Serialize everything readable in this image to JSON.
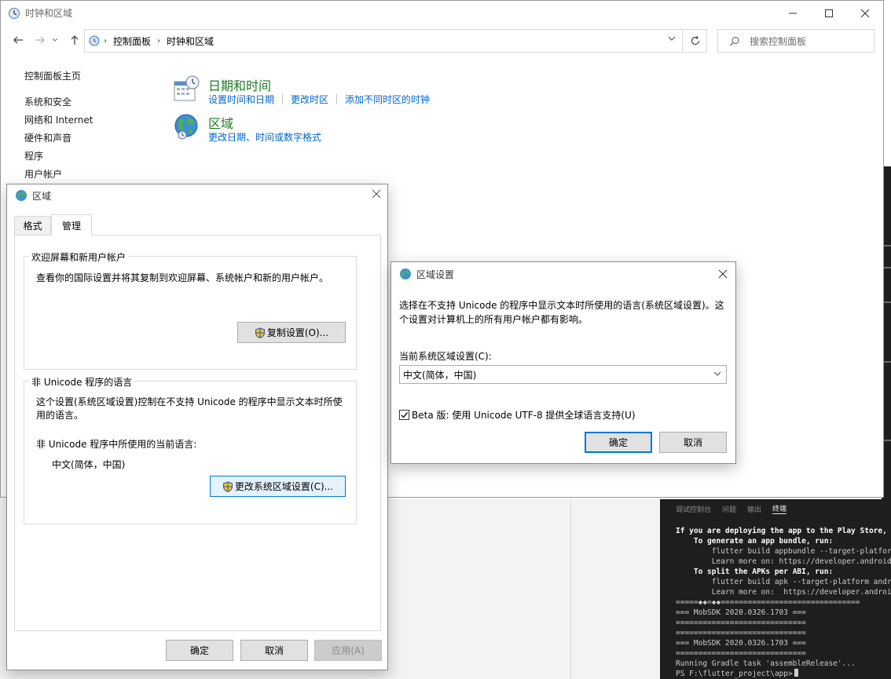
{
  "control_panel": {
    "title": "时钟和区域",
    "breadcrumb": [
      "控制面板",
      "时钟和区域"
    ],
    "search_placeholder": "搜索控制面板",
    "nav_home": "控制面板主页",
    "nav_items": [
      "系统和安全",
      "网络和 Internet",
      "硬件和声音",
      "程序",
      "用户帐户"
    ],
    "categories": [
      {
        "title": "日期和时间",
        "links": [
          "设置时间和日期",
          "更改时区",
          "添加不同时区的时钟"
        ],
        "icon": "clock-calendar-icon"
      },
      {
        "title": "区域",
        "links": [
          "更改日期、时间或数字格式"
        ],
        "icon": "globe-icon"
      }
    ]
  },
  "region_dialog": {
    "title": "区域",
    "tabs": [
      "格式",
      "管理"
    ],
    "active_tab": "管理",
    "welcome_group": {
      "label": "欢迎屏幕和新用户帐户",
      "description": "查看你的国际设置并将其复制到欢迎屏幕、系统帐户和新的用户帐户。",
      "copy_button": "复制设置(O)..."
    },
    "unicode_group": {
      "label": "非 Unicode 程序的语言",
      "description_line1": "这个设置(系统区域设置)控制在不支持 Unicode 的程序中显示文本时所使",
      "description_line2": "用的语言。",
      "current_label": "非 Unicode 程序中所使用的当前语言:",
      "current_value": "中文(简体，中国)",
      "change_button": "更改系统区域设置(C)..."
    },
    "ok": "确定",
    "cancel": "取消",
    "apply": "应用(A)"
  },
  "locale_dialog": {
    "title": "区域设置",
    "description_line1": "选择在不支持 Unicode 的程序中显示文本时所使用的语言(系统区域设置)。这",
    "description_line2": "个设置对计算机上的所有用户帐户都有影响。",
    "current_label": "当前系统区域设置(C):",
    "current_value": "中文(简体，中国)",
    "beta_checkbox": "Beta 版: 使用 Unicode UTF-8 提供全球语言支持(U)",
    "beta_checked": true,
    "ok": "确定",
    "cancel": "取消"
  },
  "terminal": {
    "tabs": [
      "调试控制台",
      "问题",
      "输出",
      "终端"
    ],
    "active_tab": "终端",
    "lines": [
      {
        "text": "If you are deploying the app to the Play Store, it'",
        "bold": true
      },
      {
        "text": "    To generate an app bundle, run:",
        "bold": true
      },
      {
        "text": "        flutter build appbundle --target-platform a",
        "bold": false
      },
      {
        "text": "        Learn more on: https://developer.android.co",
        "bold": false
      },
      {
        "text": "    To split the APKs per ABI, run:",
        "bold": true
      },
      {
        "text": "        flutter build apk --target-platform android",
        "bold": false
      },
      {
        "text": "        Learn more on:  https://developer.android.c",
        "bold": false
      },
      {
        "text": "=====◆◆=◆◆===============================",
        "bold": false
      },
      {
        "text": "=== MobSDK 2020.0326.1703 ===",
        "bold": false
      },
      {
        "text": "=============================",
        "bold": false
      },
      {
        "text": "=============================",
        "bold": false
      },
      {
        "text": "=== MobSDK 2020.0326.1703 ===",
        "bold": false
      },
      {
        "text": "=============================",
        "bold": false
      },
      {
        "text": "Running Gradle task 'assembleRelease'...",
        "bold": false
      },
      {
        "text": "PS F:\\flutter_project\\app>",
        "bold": false
      }
    ]
  },
  "colors": {
    "link": "#0066cc",
    "category_title": "#1e7a1e",
    "primary_button_border": "#0078d7",
    "terminal_bg": "#1e1e1e"
  }
}
